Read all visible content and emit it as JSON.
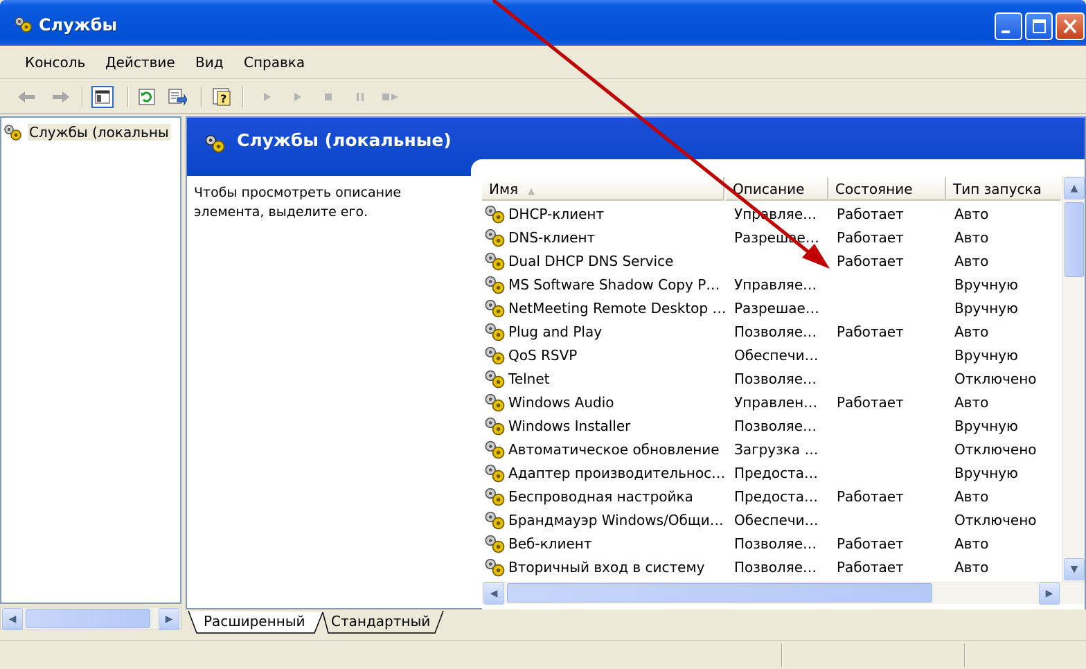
{
  "window": {
    "title": "Службы",
    "icon": "services-gear-icon"
  },
  "menu": [
    "Консоль",
    "Действие",
    "Вид",
    "Справка"
  ],
  "toolbar": {
    "icons": [
      "back-arrow-icon",
      "forward-arrow-icon",
      "show-hide-tree-icon",
      "refresh-icon",
      "export-list-icon",
      "help-icon",
      "start-service-icon",
      "start-service-alt-icon",
      "stop-service-icon",
      "pause-service-icon",
      "restart-service-icon"
    ]
  },
  "tree": {
    "item_label": "Службы (локальны"
  },
  "panel": {
    "header_title": "Службы (локальные)",
    "description": "Чтобы просмотреть описание элемента, выделите его."
  },
  "list": {
    "columns": [
      "Имя",
      "Описание",
      "Состояние",
      "Тип запуска"
    ],
    "rows": [
      {
        "name": "DHCP-клиент",
        "desc": "Управляе…",
        "state": "Работает",
        "start": "Авто"
      },
      {
        "name": "DNS-клиент",
        "desc": "Разрешае…",
        "state": "Работает",
        "start": "Авто"
      },
      {
        "name": "Dual DHCP DNS Service",
        "desc": "",
        "state": "Работает",
        "start": "Авто"
      },
      {
        "name": "MS Software Shadow Copy P…",
        "desc": "Управляе…",
        "state": "",
        "start": "Вручную"
      },
      {
        "name": "NetMeeting Remote Desktop …",
        "desc": "Разрешае…",
        "state": "",
        "start": "Вручную"
      },
      {
        "name": "Plug and Play",
        "desc": "Позволяе…",
        "state": "Работает",
        "start": "Авто"
      },
      {
        "name": "QoS RSVP",
        "desc": "Обеспечи…",
        "state": "",
        "start": "Вручную"
      },
      {
        "name": "Telnet",
        "desc": "Позволяе…",
        "state": "",
        "start": "Отключено"
      },
      {
        "name": "Windows Audio",
        "desc": "Управлен…",
        "state": "Работает",
        "start": "Авто"
      },
      {
        "name": "Windows Installer",
        "desc": "Позволяе…",
        "state": "",
        "start": "Вручную"
      },
      {
        "name": "Автоматическое обновление",
        "desc": "Загрузка …",
        "state": "",
        "start": "Отключено"
      },
      {
        "name": "Адаптер производительнос…",
        "desc": "Предоста…",
        "state": "",
        "start": "Вручную"
      },
      {
        "name": "Беспроводная настройка",
        "desc": "Предоста…",
        "state": "Работает",
        "start": "Авто"
      },
      {
        "name": "Брандмауэр Windows/Общи…",
        "desc": "Обеспечи…",
        "state": "",
        "start": "Отключено"
      },
      {
        "name": "Веб-клиент",
        "desc": "Позволяе…",
        "state": "Работает",
        "start": "Авто"
      },
      {
        "name": "Вторичный вход в систему",
        "desc": "Позволяе…",
        "state": "Работает",
        "start": "Авто"
      }
    ]
  },
  "tabs": [
    "Расширенный",
    "Стандартный"
  ],
  "colors": {
    "titlebar": "#0653d8",
    "panel_header": "#0a44c8",
    "annotation_arrow": "#c00000",
    "chrome": "#ece9d8"
  }
}
